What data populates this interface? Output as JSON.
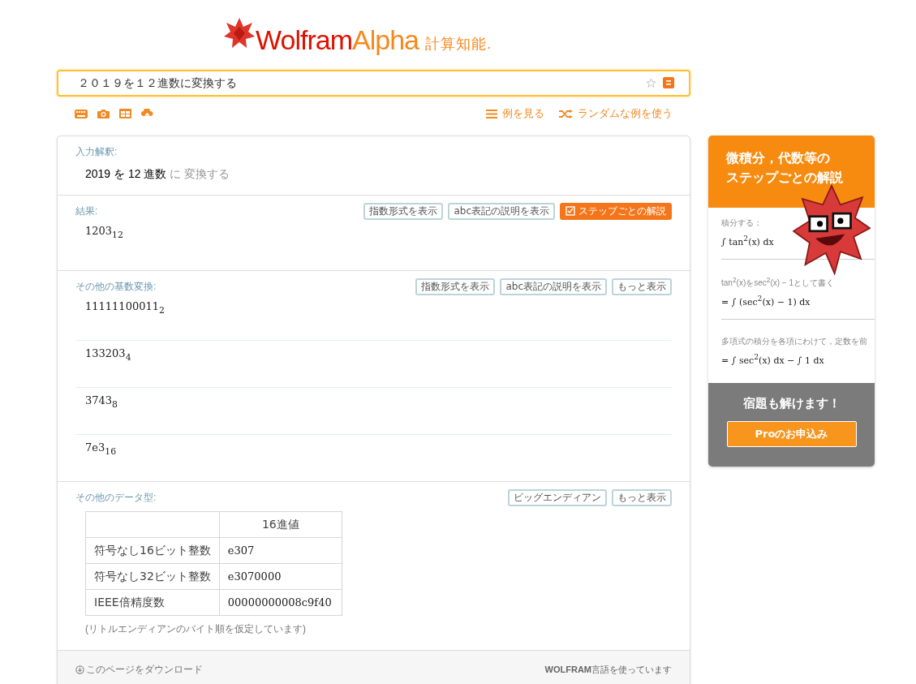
{
  "header": {
    "logo_main": "Wolfram",
    "logo_accent": "Alpha",
    "logo_tag": "計算知能."
  },
  "search": {
    "value": "２０１９を１２進数に変換する"
  },
  "toolbar": {
    "tools": [
      {
        "kind": "keyboard"
      },
      {
        "kind": "camera"
      },
      {
        "kind": "table"
      },
      {
        "kind": "upload"
      }
    ],
    "links": [
      {
        "kind": "list",
        "label": "例を見る"
      },
      {
        "kind": "shuffle",
        "label": "ランダムな例を使う"
      }
    ]
  },
  "pods": [
    {
      "kind": "interpretation",
      "title": "入力解釈:",
      "parts": [
        {
          "text": "2019 を 12 進数",
          "muted": false
        },
        {
          "text": "に 変換する",
          "muted": true
        }
      ]
    },
    {
      "kind": "results",
      "title": "結果:",
      "buttons": [
        {
          "kind": "plain",
          "label": "指数形式を表示"
        },
        {
          "kind": "plain",
          "label": "abc表記の説明を表示"
        },
        {
          "kind": "steps",
          "label": "ステップごとの解説"
        }
      ],
      "results": [
        "1203$_{12}$"
      ]
    },
    {
      "kind": "results",
      "title": "その他の基数変換:",
      "buttons": [
        {
          "kind": "plain",
          "label": "指数形式を表示"
        },
        {
          "kind": "plain",
          "label": "abc表記の説明を表示"
        },
        {
          "kind": "plain",
          "label": "もっと表示"
        }
      ],
      "results": [
        "11111100011$_{2}$",
        "133203$_{4}$",
        "3743$_{8}$",
        "7e3$_{16}$"
      ]
    },
    {
      "kind": "table",
      "title": "その他のデータ型:",
      "buttons": [
        {
          "kind": "plain",
          "label": "ビッグエンディアン"
        },
        {
          "kind": "plain",
          "label": "もっと表示"
        }
      ],
      "columns": [
        "16進値"
      ],
      "rows": [
        {
          "label": "符号なし16ビット整数",
          "value": "e307"
        },
        {
          "label": "符号なし32ビット整数",
          "value": "e3070000"
        },
        {
          "label": "IEEE倍精度数",
          "value": "00000000008c9f40"
        }
      ],
      "note": "(リトルエンディアンのバイト順を仮定しています)"
    }
  ],
  "footer": {
    "download": "このページをダウンロード",
    "powered": "**WOLFRAM**言語を使っています"
  },
  "ad": {
    "heading": [
      "微積分，代数等の",
      "ステップごとの解説"
    ],
    "steps": [
      {
        "label": "積分する：",
        "formula": "∫ tan$^{2}$(x) dx"
      },
      {
        "label": "tan$^{2}$(x)をsec$^{2}$(x) − 1として書く",
        "formula": "= ∫ (sec$^{2}$(x) − 1) dx"
      },
      {
        "label": "多項式の積分を各項にわけて，定数を前",
        "formula": "= ∫ sec$^{2}$(x) dx − ∫ 1 dx"
      }
    ],
    "tagline": "宿題も解けます！",
    "cta": "Proのお申込み"
  }
}
